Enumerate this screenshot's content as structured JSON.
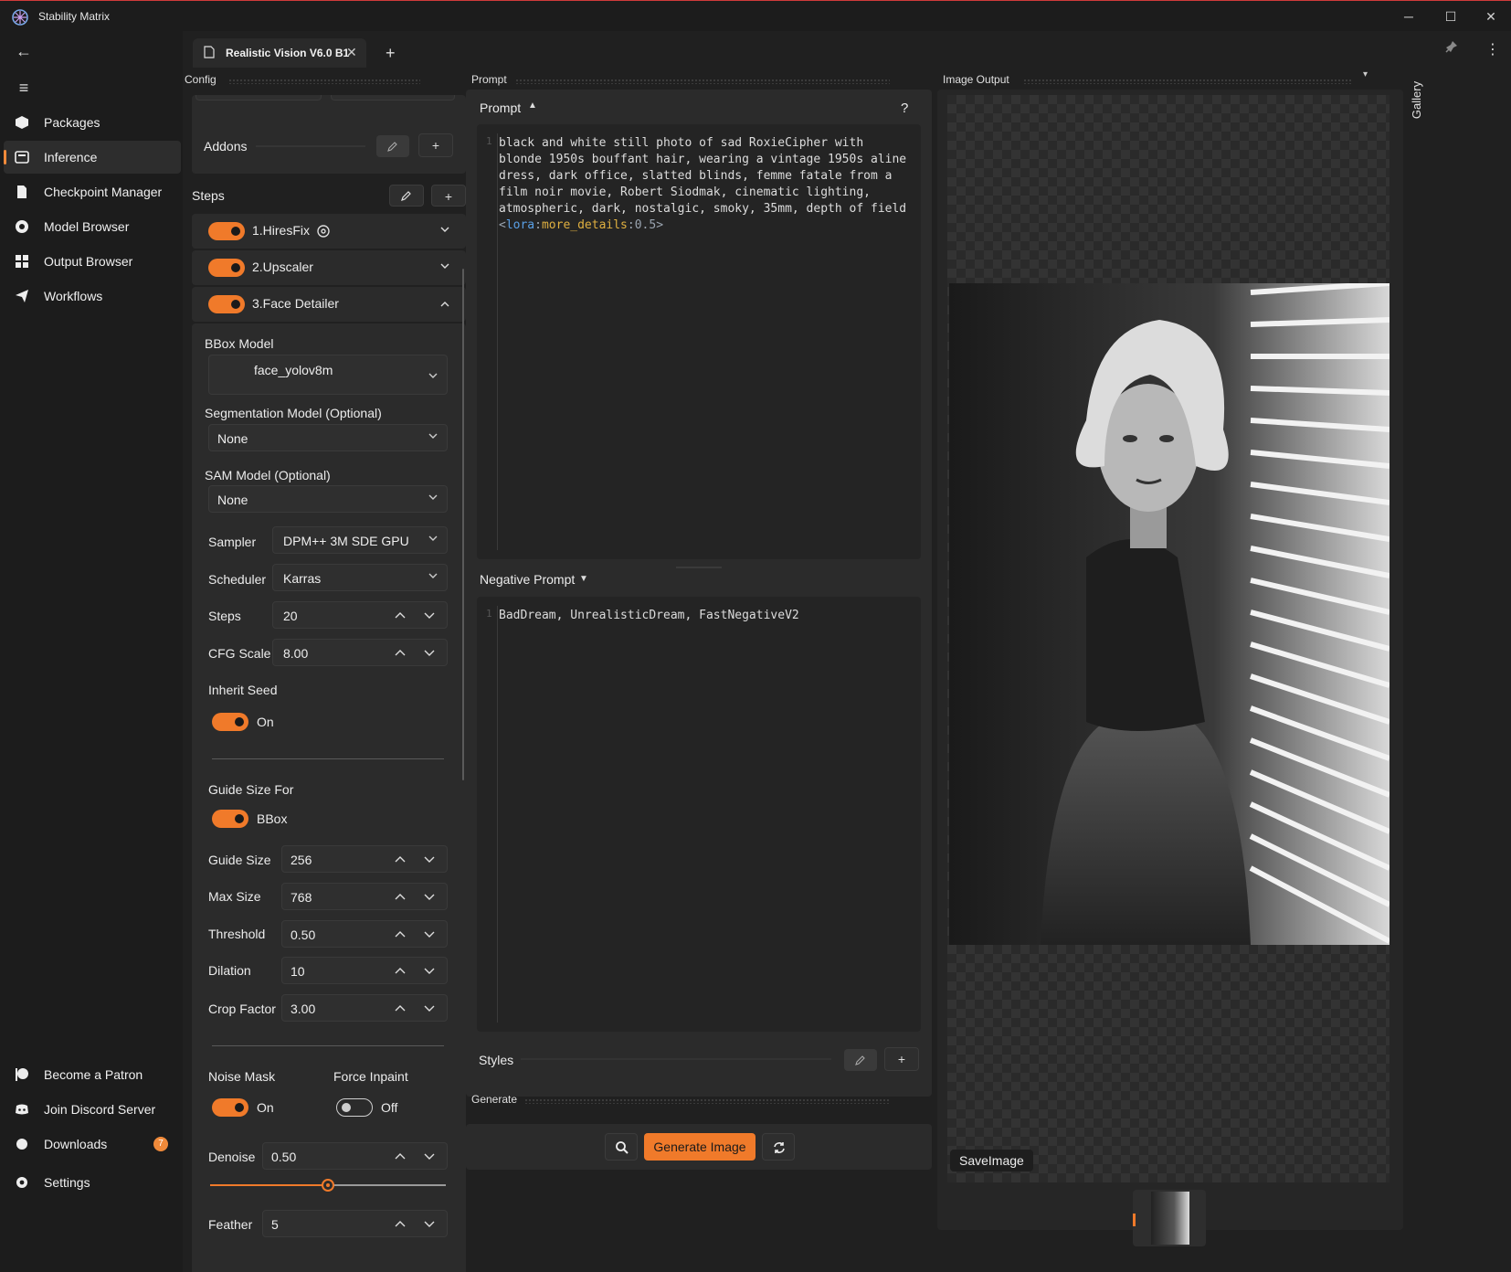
{
  "app": {
    "title": "Stability Matrix"
  },
  "sidebar": {
    "items": [
      {
        "label": "Packages",
        "icon": "package-icon"
      },
      {
        "label": "Inference",
        "icon": "inference-icon",
        "active": true
      },
      {
        "label": "Checkpoint Manager",
        "icon": "checkpoint-icon"
      },
      {
        "label": "Model Browser",
        "icon": "model-browser-icon"
      },
      {
        "label": "Output Browser",
        "icon": "grid-icon"
      },
      {
        "label": "Workflows",
        "icon": "workflow-icon"
      }
    ],
    "footer": [
      {
        "label": "Become a Patron",
        "icon": "patreon-icon"
      },
      {
        "label": "Join Discord Server",
        "icon": "discord-icon"
      },
      {
        "label": "Downloads",
        "icon": "download-icon",
        "badge": "7"
      },
      {
        "label": "Settings",
        "icon": "gear-icon"
      }
    ]
  },
  "tabs": {
    "active": "Realistic Vision V6.0 B1"
  },
  "panels": {
    "config": "Config",
    "prompt": "Prompt",
    "image_output": "Image Output",
    "generate": "Generate",
    "gallery": "Gallery"
  },
  "config": {
    "addons_label": "Addons",
    "steps_label": "Steps",
    "steps": [
      {
        "label": "1.HiresFix"
      },
      {
        "label": "2.Upscaler"
      },
      {
        "label": "3.Face Detailer"
      }
    ],
    "face_detailer": {
      "bbox_model_label": "BBox Model",
      "bbox_model": "face_yolov8m",
      "seg_model_label": "Segmentation Model (Optional)",
      "seg_model": "None",
      "sam_model_label": "SAM Model (Optional)",
      "sam_model": "None",
      "sampler_label": "Sampler",
      "sampler": "DPM++ 3M SDE GPU",
      "scheduler_label": "Scheduler",
      "scheduler": "Karras",
      "steps_label": "Steps",
      "steps": "20",
      "cfg_label": "CFG Scale",
      "cfg": "8.00",
      "inherit_seed_label": "Inherit Seed",
      "inherit_seed": "On",
      "guide_size_for_label": "Guide Size For",
      "guide_size_for": "BBox",
      "guide_size_label": "Guide Size",
      "guide_size": "256",
      "max_size_label": "Max Size",
      "max_size": "768",
      "threshold_label": "Threshold",
      "threshold": "0.50",
      "dilation_label": "Dilation",
      "dilation": "10",
      "crop_factor_label": "Crop Factor",
      "crop_factor": "3.00",
      "noise_mask_label": "Noise Mask",
      "noise_mask": "On",
      "force_inpaint_label": "Force Inpaint",
      "force_inpaint": "Off",
      "denoise_label": "Denoise",
      "denoise": "0.50",
      "denoise_fraction": 0.5,
      "feather_label": "Feather",
      "feather": "5"
    }
  },
  "prompt": {
    "header": "Prompt",
    "help": "?",
    "line_number": "1",
    "text": "black and white still photo of sad RoxieCipher with blonde 1950s bouffant hair, wearing a vintage 1950s aline dress, dark office, slatted blinds, femme fatale from a film noir movie, Robert Siodmak, cinematic lighting, atmospheric, dark, nostalgic, smoky, 35mm, depth of field",
    "lora_open": "<",
    "lora_kw": "lora",
    "lora_sep": ":",
    "lora_name": "more_details",
    "lora_weight": ":0.5",
    "lora_close": ">",
    "negative_header": "Negative Prompt",
    "negative_text": "BadDream, UnrealisticDream, FastNegativeV2",
    "styles_label": "Styles"
  },
  "generate": {
    "button": "Generate Image"
  },
  "image_output": {
    "save_label": "SaveImage"
  },
  "colors": {
    "accent": "#f07a2a",
    "background": "#202020",
    "panel": "#2b2b2b",
    "lora_keyword": "#5aa0e6",
    "lora_name": "#e0b040"
  }
}
